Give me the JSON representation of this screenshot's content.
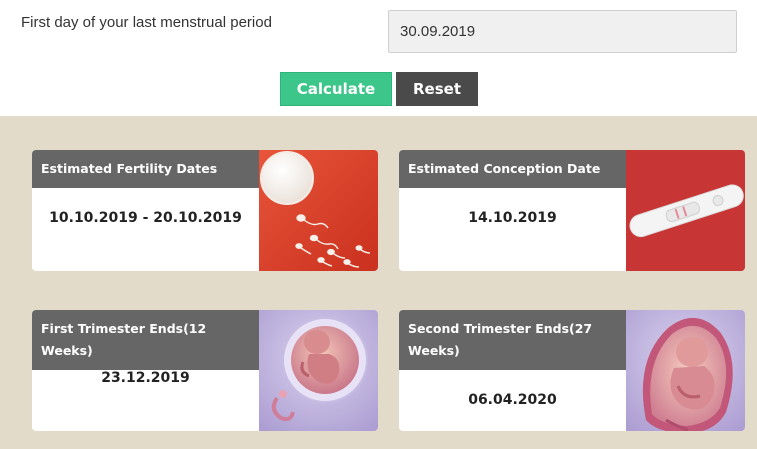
{
  "form": {
    "label": "First day of your last menstrual period",
    "date_value": "30.09.2019",
    "calculate_label": "Calculate",
    "reset_label": "Reset"
  },
  "results": [
    {
      "title": "Estimated Fertility Dates",
      "value": "10.10.2019 - 20.10.2019",
      "image": "sperm-egg-illustration"
    },
    {
      "title": "Estimated Conception Date",
      "value": "14.10.2019",
      "image": "pregnancy-test-illustration"
    },
    {
      "title": "First Trimester Ends(12 Weeks)",
      "value": "23.12.2019",
      "image": "fetus-12-weeks-illustration"
    },
    {
      "title": "Second Trimester Ends(27 Weeks)",
      "value": "06.04.2020",
      "image": "fetus-27-weeks-illustration"
    }
  ],
  "colors": {
    "calculate": "#3cc68a",
    "reset": "#4a4a4a",
    "card_header": "#666666",
    "results_background": "#e3dbca"
  }
}
